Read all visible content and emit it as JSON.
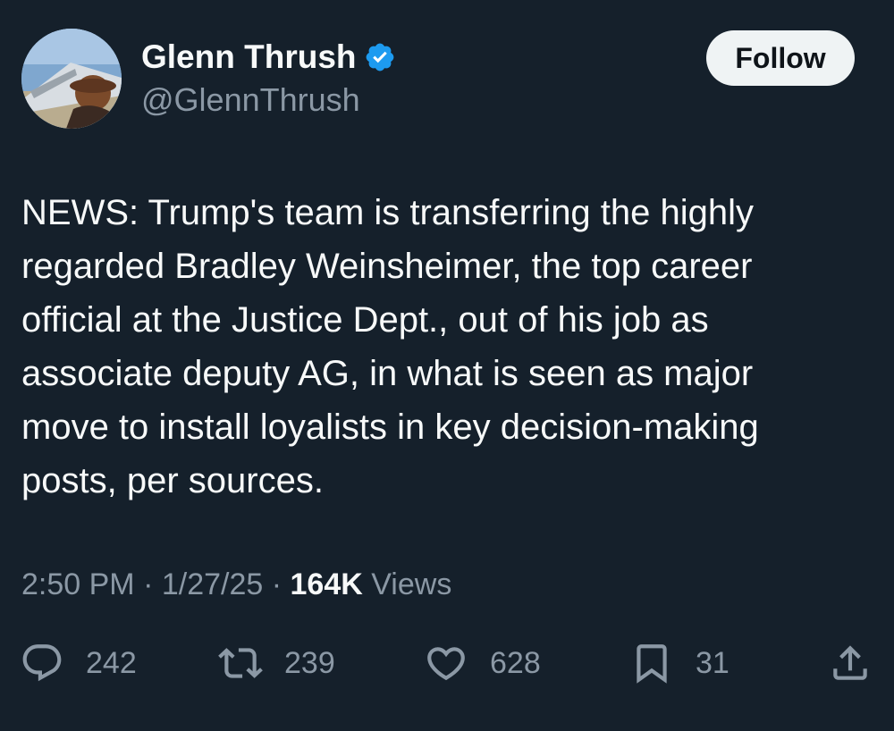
{
  "author": {
    "display_name": "Glenn Thrush",
    "handle": "@GlennThrush",
    "verified": true,
    "avatar_icon": "profile-photo"
  },
  "follow_button": {
    "label": "Follow"
  },
  "tweet": {
    "lines": [
      "NEWS: Trump's team is transferring the highly",
      "regarded Bradley Weinsheimer, the top career",
      "official at the Justice Dept., out of his job as",
      "associate deputy AG, in what is seen as major",
      "move to install loyalists in key decision-making",
      "posts, per sources."
    ]
  },
  "meta": {
    "time": "2:50 PM",
    "sep1": " · ",
    "date": "1/27/25",
    "sep2": " · ",
    "views_count": "164K",
    "views_label": " Views"
  },
  "actions": {
    "replies": "242",
    "retweets": "239",
    "likes": "628",
    "bookmarks": "31"
  },
  "colors": {
    "background": "#15202b",
    "text": "#f7f9f9",
    "secondary": "#8b98a5",
    "verified": "#1d9bf0"
  }
}
